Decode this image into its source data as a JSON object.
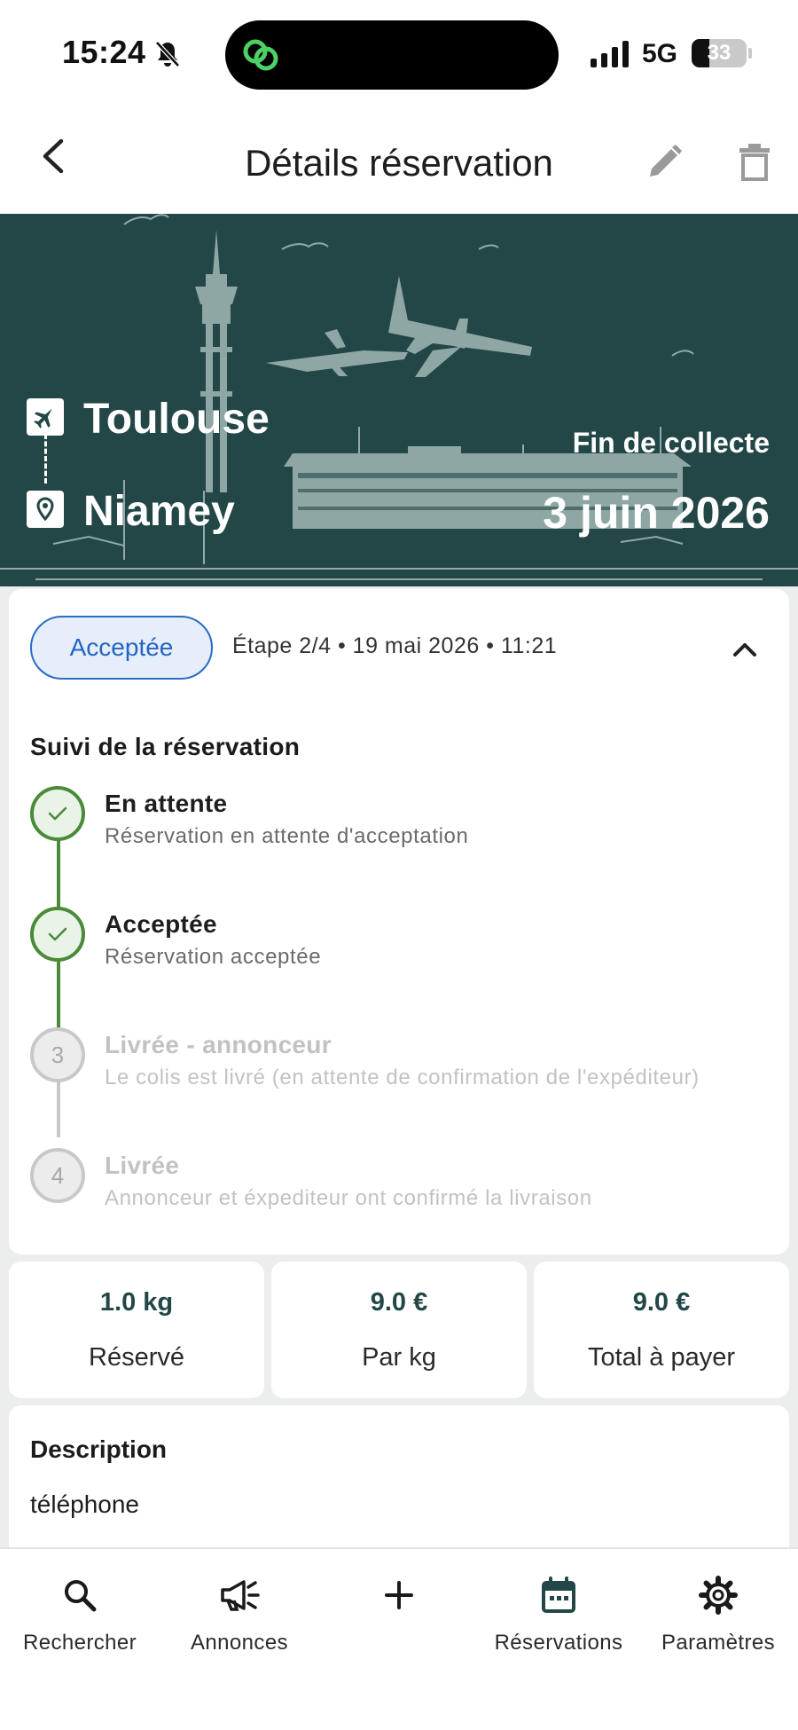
{
  "status_bar": {
    "time": "15:24",
    "network": "5G",
    "battery": "33",
    "battery_level": 0.33
  },
  "header": {
    "title": "Détails réservation"
  },
  "route": {
    "origin": "Toulouse",
    "destination": "Niamey",
    "collect_label": "Fin de collecte",
    "collect_date": "3 juin 2026"
  },
  "status": {
    "badge": "Acceptée",
    "step_info": "Étape 2/4 • 19 mai 2026 • 11:21"
  },
  "tracking": {
    "title": "Suivi de la réservation",
    "steps": [
      {
        "marker": "",
        "title": "En attente",
        "description": "Réservation en attente d'acceptation",
        "state": "done"
      },
      {
        "marker": "",
        "title": "Acceptée",
        "description": "Réservation acceptée",
        "state": "done"
      },
      {
        "marker": "3",
        "title": "Livrée - annonceur",
        "description": "Le colis est livré (en attente de confirmation de l'expéditeur)",
        "state": "todo"
      },
      {
        "marker": "4",
        "title": "Livrée",
        "description": "Annonceur et éxpediteur ont confirmé la livraison",
        "state": "todo"
      }
    ]
  },
  "stats": [
    {
      "value": "1.0 kg",
      "label": "Réservé"
    },
    {
      "value": "9.0 €",
      "label": "Par kg"
    },
    {
      "value": "9.0 €",
      "label": "Total à payer"
    }
  ],
  "description": {
    "title": "Description",
    "text": "téléphone"
  },
  "nav": [
    {
      "label": "Rechercher",
      "icon": "search-icon"
    },
    {
      "label": "Annonces",
      "icon": "megaphone-icon"
    },
    {
      "label": "",
      "icon": "plus-icon"
    },
    {
      "label": "Réservations",
      "icon": "calendar-icon"
    },
    {
      "label": "Paramètres",
      "icon": "gear-icon"
    }
  ],
  "colors": {
    "primary": "#234647",
    "accent_blue": "#2b6cc4",
    "success_green": "#4a8a38"
  }
}
